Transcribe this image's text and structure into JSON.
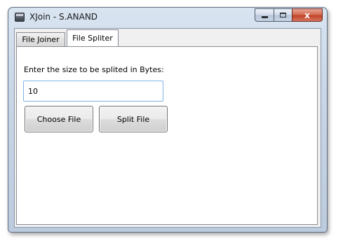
{
  "window": {
    "title": "XJoin - S.ANAND",
    "caption_buttons": {
      "close_glyph": "x"
    }
  },
  "tabs": [
    {
      "label": "File Joiner",
      "active": false
    },
    {
      "label": "File Spliter",
      "active": true
    }
  ],
  "split_panel": {
    "size_label": "Enter the size to be splited in Bytes:",
    "size_value": "10",
    "choose_button": "Choose File",
    "split_button": "Split File"
  },
  "icons": {
    "app": "app-window-icon",
    "minimize": "minimize-icon",
    "maximize": "maximize-icon",
    "close": "close-icon"
  },
  "colors": {
    "titlebar": "#c8d6e8",
    "close_button": "#c1432a",
    "input_border": "#7eb4ea"
  }
}
